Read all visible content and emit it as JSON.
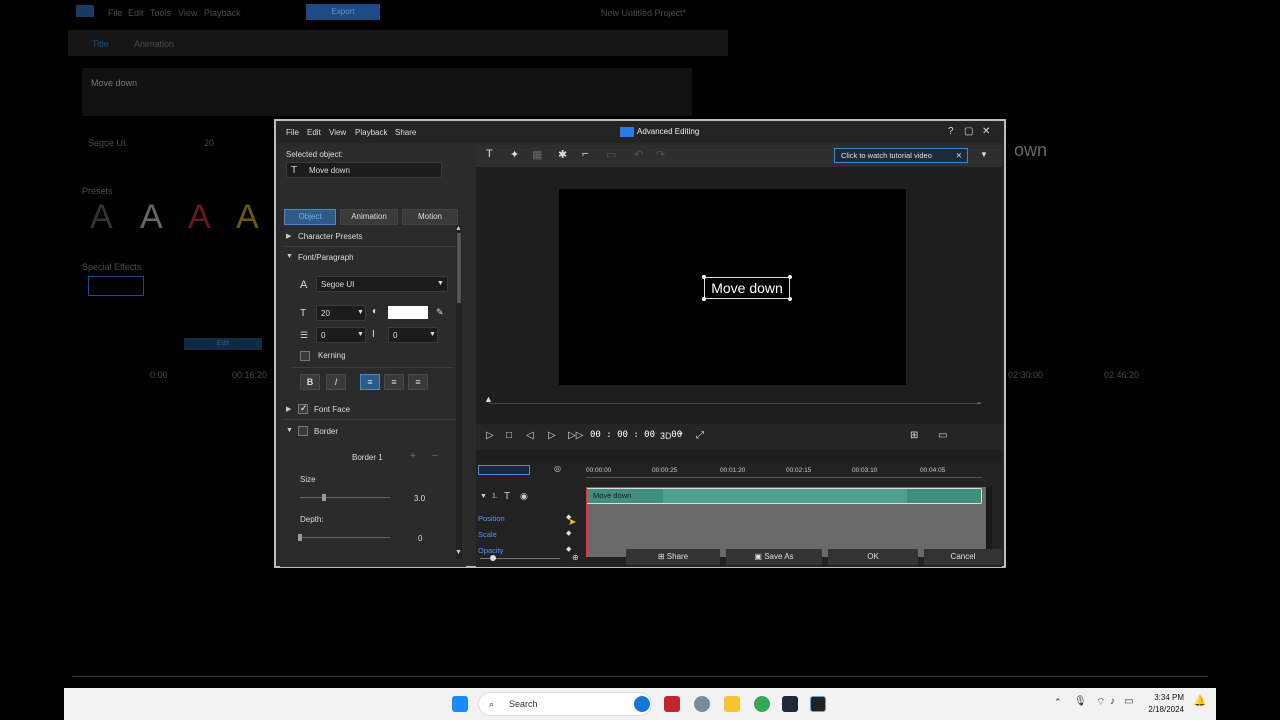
{
  "background_app": {
    "menu": [
      "File",
      "Edit",
      "Tools",
      "View",
      "Playback"
    ],
    "export_label": "Export",
    "title": "New Untitled Project*",
    "panel_tabs": [
      "Title",
      "Animation"
    ],
    "title_text": "Move down",
    "font": "Segoe UI",
    "size": "20",
    "presets_label": "Presets",
    "special_effects_label": "Special Effects",
    "preview_word": "own",
    "edit_label": "Edit",
    "timecodes": [
      "0:00",
      "00:16:20",
      "02:30:00",
      "02:46:20"
    ]
  },
  "window": {
    "title": "Advanced Editing",
    "menu": [
      "File",
      "Edit",
      "View",
      "Playback",
      "Share"
    ]
  },
  "left": {
    "selected_label": "Selected object:",
    "object_name": "Move down",
    "tabs": [
      "Object",
      "Animation",
      "Motion"
    ],
    "sections": {
      "character_presets": "Character Presets",
      "font_paragraph": "Font/Paragraph",
      "font_face": "Font Face",
      "border": "Border"
    },
    "font": "Segoe UI",
    "font_size": "20",
    "line_spacing": "0",
    "char_spacing": "0",
    "kerning": "Kerning",
    "bold": "B",
    "italic": "I",
    "border_title": "Border 1",
    "size_label": "Size",
    "size_value": "3.0",
    "depth_label": "Depth:",
    "depth_value": "0",
    "color_hex": "#ffffff"
  },
  "right": {
    "tutorial": "Click to watch tutorial video",
    "preview_text": "Move down",
    "timecode": "00 : 00 : 00 : 00",
    "three_d": "3D",
    "ruler": [
      "00:00:00",
      "00:00:25",
      "00:01:20",
      "00:02:15",
      "00:03:10",
      "00:04:05"
    ],
    "track_index": "1.",
    "clip_label": "Move down",
    "attributes": [
      "Position",
      "Scale",
      "Opacity"
    ]
  },
  "bottom": {
    "share": "Share",
    "save_as": "Save As",
    "ok": "OK",
    "cancel": "Cancel"
  },
  "taskbar": {
    "search_placeholder": "Search",
    "time": "3:34 PM",
    "date": "2/18/2024"
  },
  "colors": {
    "accent": "#2f5a86",
    "clip": "#4fa08c",
    "link": "#4e9bff"
  }
}
